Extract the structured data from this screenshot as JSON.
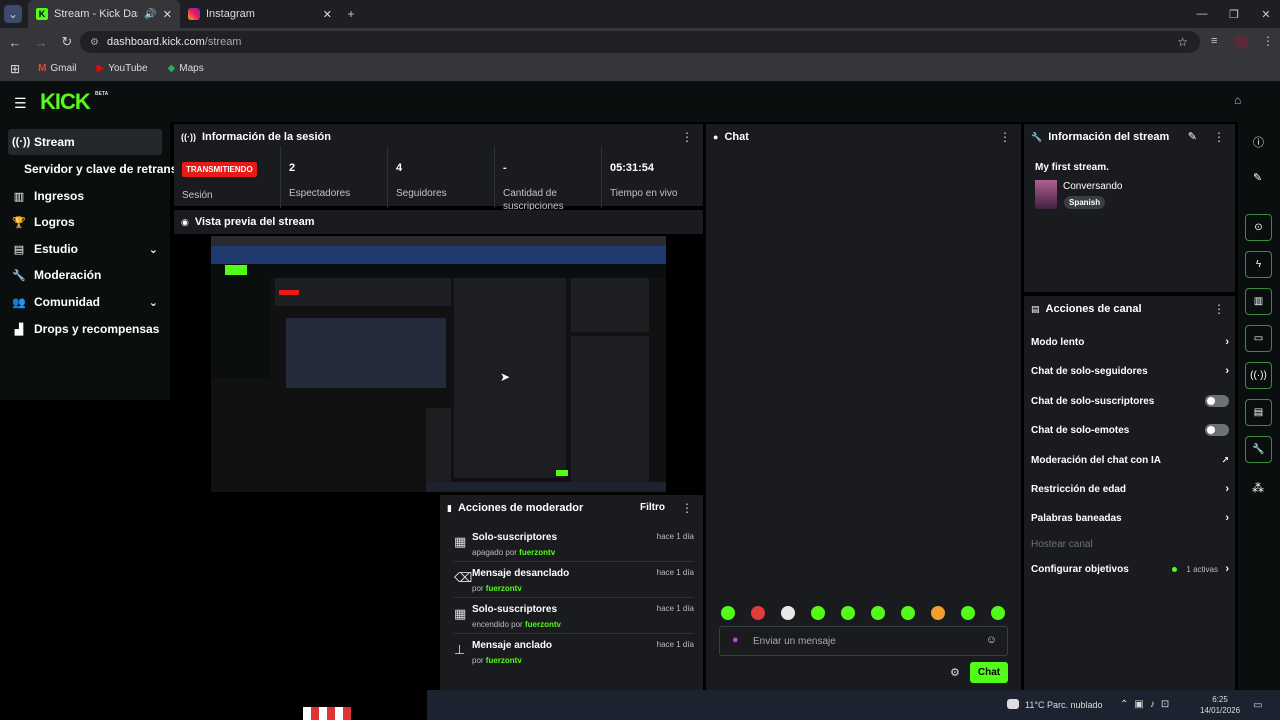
{
  "browser": {
    "tabs": [
      {
        "title": "Stream - Kick Dashboard",
        "active": true
      },
      {
        "title": "Instagram",
        "active": false
      }
    ],
    "url_host": "dashboard.kick.com",
    "url_path": "/stream",
    "bookmarks": [
      "Gmail",
      "YouTube",
      "Maps"
    ]
  },
  "header": {
    "logo": "KICK",
    "beta": "BETA"
  },
  "sidebar": {
    "items": [
      {
        "label": "Stream",
        "icon": "broadcast-icon",
        "active": true
      },
      {
        "label": "Servidor y clave de retransm",
        "sub": true
      },
      {
        "label": "Ingresos",
        "icon": "chart-icon"
      },
      {
        "label": "Logros",
        "icon": "trophy-icon"
      },
      {
        "label": "Estudio",
        "icon": "studio-icon",
        "expandable": true
      },
      {
        "label": "Moderación",
        "icon": "wrench-icon"
      },
      {
        "label": "Comunidad",
        "icon": "people-icon",
        "expandable": true
      },
      {
        "label": "Drops y recompensas",
        "icon": "gift-icon"
      }
    ]
  },
  "session": {
    "title": "Información de la sesión",
    "live_badge": "TRANSMITIENDO",
    "stats": [
      {
        "value": "",
        "label": "Sesión"
      },
      {
        "value": "2",
        "label": "Espectadores"
      },
      {
        "value": "4",
        "label": "Seguidores"
      },
      {
        "value": "-",
        "label": "Cantidad de suscripciones"
      },
      {
        "value": "05:31:54",
        "label": "Tiempo en vivo"
      }
    ]
  },
  "preview": {
    "title": "Vista previa del stream"
  },
  "mod_actions": {
    "title": "Acciones de moderador",
    "filter": "Filtro",
    "items": [
      {
        "title": "Solo-suscriptores",
        "prefix": "apagado por",
        "user": "fuerzontv",
        "time": "hace 1 día",
        "icon": "gift-icon"
      },
      {
        "title": "Mensaje desanclado",
        "prefix": "por",
        "user": "fuerzontv",
        "time": "hace 1 día",
        "icon": "unpin-icon"
      },
      {
        "title": "Solo-suscriptores",
        "prefix": "encendido por",
        "user": "fuerzontv",
        "time": "hace 1 día",
        "icon": "gift-icon"
      },
      {
        "title": "Mensaje anclado",
        "prefix": "por",
        "user": "fuerzontv",
        "time": "hace 1 día",
        "icon": "pin-icon"
      }
    ]
  },
  "chat": {
    "title": "Chat",
    "placeholder": "Enviar un mensaje",
    "send_label": "Chat"
  },
  "stream_info": {
    "title": "Información del stream",
    "stream_title": "My first stream.",
    "category": "Conversando",
    "language": "Spanish"
  },
  "channel_actions": {
    "title": "Acciones de canal",
    "items": [
      {
        "label": "Modo lento",
        "control": "chevron"
      },
      {
        "label": "Chat de solo-seguidores",
        "control": "chevron"
      },
      {
        "label": "Chat de solo-suscriptores",
        "control": "toggle"
      },
      {
        "label": "Chat de solo-emotes",
        "control": "toggle"
      },
      {
        "label": "Moderación del chat con IA",
        "control": "external"
      },
      {
        "label": "Restricción de edad",
        "control": "chevron"
      },
      {
        "label": "Palabras baneadas",
        "control": "chevron"
      },
      {
        "label": "Hostear canal",
        "control": "none",
        "disabled": true
      },
      {
        "label": "Configurar objetivos",
        "control": "chevron",
        "extra": "1 activas"
      }
    ]
  },
  "taskbar": {
    "weather": "11°C  Parc. nublado",
    "time": "6:25",
    "date": "14/01/2026"
  },
  "colors": {
    "brand": "#53fc18",
    "live": "#e91916",
    "panel": "#191b1f",
    "bg": "#000000"
  }
}
